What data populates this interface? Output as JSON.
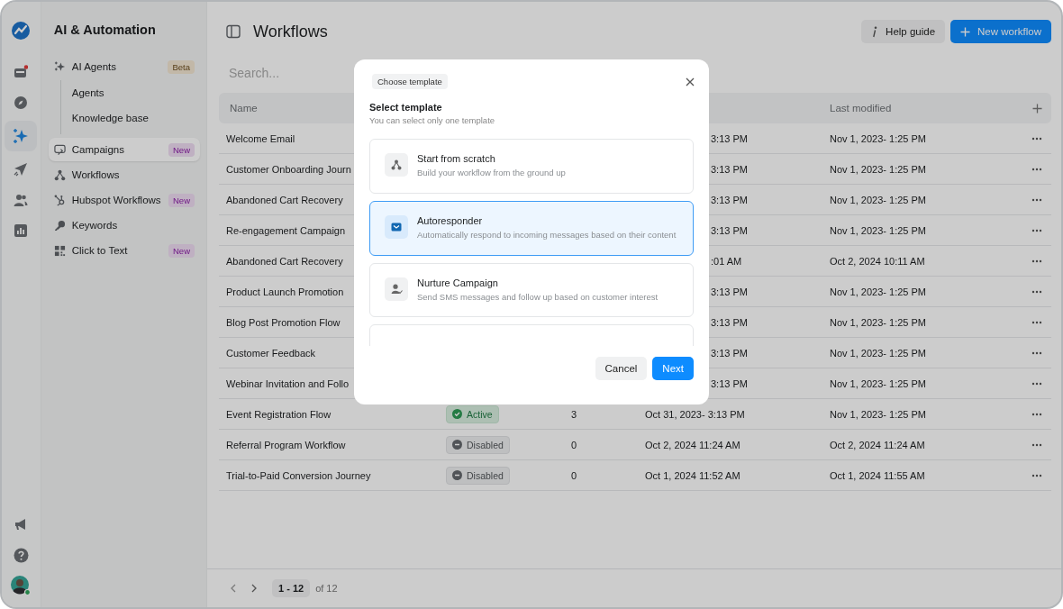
{
  "rail": {
    "items": [
      {
        "selected": false
      },
      {
        "selected": false,
        "notify": true
      },
      {
        "selected": false
      },
      {
        "selected": true
      },
      {
        "selected": false
      },
      {
        "selected": false
      },
      {
        "selected": false
      }
    ],
    "bottom": [
      {
        "selected": false
      },
      {
        "selected": false
      }
    ],
    "avatar": {
      "online": true
    }
  },
  "nav": {
    "title": "AI & Automation",
    "items": [
      {
        "label": "AI Agents",
        "selected": false,
        "badge": {
          "label": "Beta",
          "kind": "beta"
        },
        "children": [
          {
            "label": "Agents",
            "selected": false
          },
          {
            "label": "Knowledge base",
            "selected": false
          }
        ]
      },
      {
        "label": "Campaigns",
        "selected": true,
        "badge": {
          "label": "New",
          "kind": "new"
        }
      },
      {
        "label": "Workflows",
        "selected": false
      },
      {
        "label": "Hubspot Workflows",
        "selected": false,
        "badge": {
          "label": "New",
          "kind": "new"
        }
      },
      {
        "label": "Keywords",
        "selected": false
      },
      {
        "label": "Click to Text",
        "selected": false,
        "badge": {
          "label": "New",
          "kind": "new"
        }
      }
    ]
  },
  "header": {
    "title": "Workflows",
    "help_button": "Help guide",
    "new_button": "New workflow"
  },
  "search": {
    "placeholder": "Search..."
  },
  "table": {
    "columns": {
      "name": "Name",
      "last_modified": "Last modified"
    },
    "rows": [
      {
        "name": "Welcome Email",
        "created": "3:13 PM",
        "modified": "Nov 1, 2023- 1:25 PM"
      },
      {
        "name": "Customer Onboarding Journ",
        "created": "3:13 PM",
        "modified": "Nov 1, 2023- 1:25 PM"
      },
      {
        "name": "Abandoned Cart Recovery",
        "created": "3:13 PM",
        "modified": "Nov 1, 2023- 1:25 PM"
      },
      {
        "name": "Re-engagement Campaign",
        "created": "3:13 PM",
        "modified": "Nov 1, 2023- 1:25 PM"
      },
      {
        "name": "Abandoned Cart Recovery",
        "created": ":01 AM",
        "modified": "Oct 2, 2024 10:11 AM"
      },
      {
        "name": "Product Launch Promotion",
        "created": "3:13 PM",
        "modified": "Nov 1, 2023- 1:25 PM"
      },
      {
        "name": "Blog Post Promotion Flow",
        "created": "3:13 PM",
        "modified": "Nov 1, 2023- 1:25 PM"
      },
      {
        "name": "Customer Feedback",
        "created": "3:13 PM",
        "modified": "Nov 1, 2023- 1:25 PM"
      },
      {
        "name": "Webinar Invitation and Follo",
        "created": "3:13 PM",
        "modified": "Nov 1, 2023- 1:25 PM"
      },
      {
        "name": "Event Registration Flow",
        "status": {
          "label": "Active",
          "kind": "active"
        },
        "steps": "3",
        "created": "Oct 31, 2023- 3:13 PM",
        "modified": "Nov 1, 2023- 1:25 PM"
      },
      {
        "name": "Referral Program Workflow",
        "status": {
          "label": "Disabled",
          "kind": "disabled"
        },
        "steps": "0",
        "created": "Oct 2, 2024 11:24 AM",
        "modified": "Oct 2, 2024 11:24 AM"
      },
      {
        "name": "Trial-to-Paid Conversion Journey",
        "status": {
          "label": "Disabled",
          "kind": "disabled"
        },
        "steps": "0",
        "created": "Oct 1, 2024 11:52 AM",
        "modified": "Oct 1, 2024 11:55 AM"
      }
    ]
  },
  "pagination": {
    "range": "1 - 12",
    "total": "of 12"
  },
  "modal": {
    "chip": "Choose template",
    "title": "Select template",
    "subtitle": "You can select only one template",
    "templates": [
      {
        "title": "Start from scratch",
        "description": "Build your workflow from the ground up",
        "selected": false
      },
      {
        "title": "Autoresponder",
        "description": "Automatically respond to incoming messages based on their content",
        "selected": true
      },
      {
        "title": "Nurture Campaign",
        "description": "Send SMS messages and follow up based on customer interest",
        "selected": false
      },
      {
        "selected": false
      }
    ],
    "cancel": "Cancel",
    "next": "Next"
  }
}
